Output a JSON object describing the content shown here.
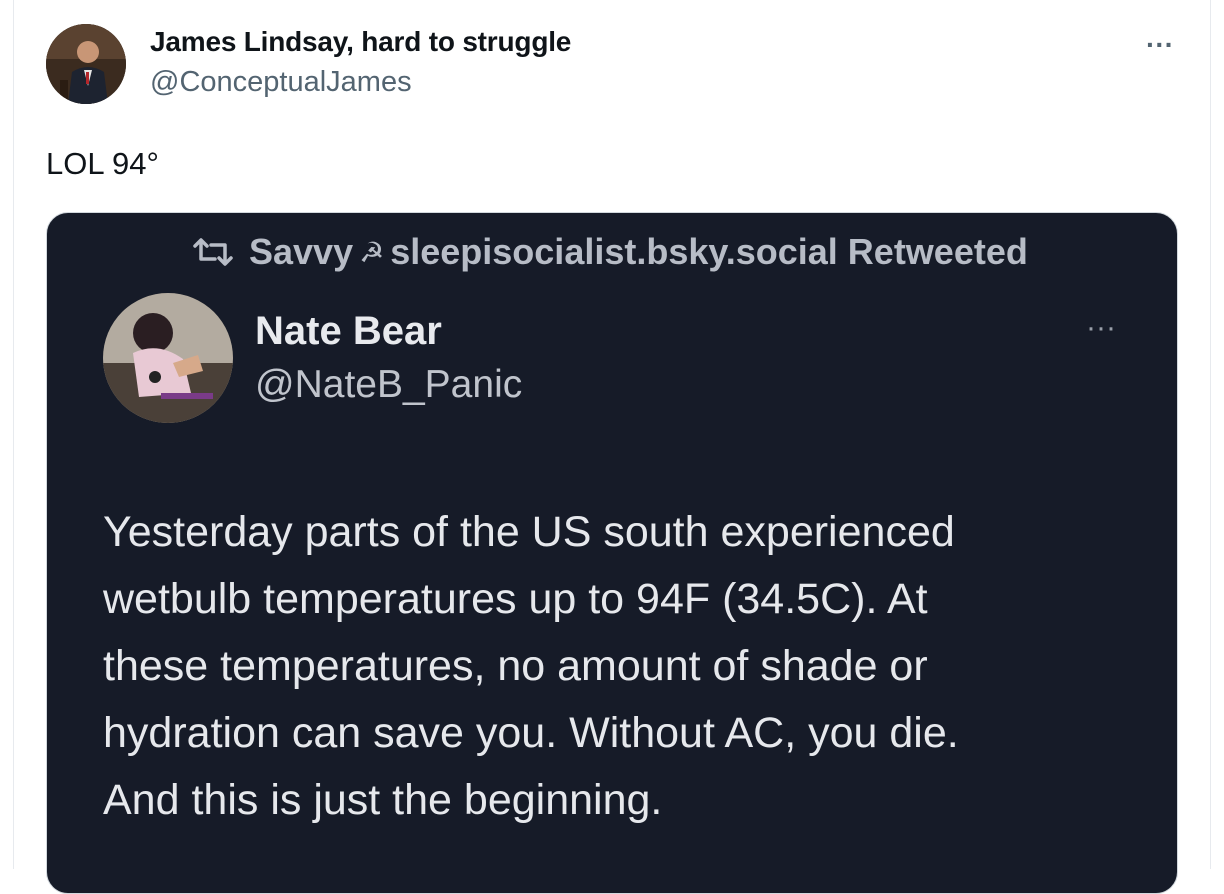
{
  "tweet": {
    "author_name": "James Lindsay, hard to struggle",
    "author_handle": "@ConceptualJames",
    "more_label": "···",
    "text": "LOL 94°",
    "avatar_icon": "user-avatar-photo"
  },
  "embedded_screenshot": {
    "retweet_icon": "retweet-icon",
    "retweeter": "Savvy",
    "retweeter_symbol": "☭",
    "retweeter_rest": "sleepisocialist.bsky.social Retweeted",
    "author_name": "Nate Bear",
    "author_handle": "@NateB_Panic",
    "more_label": "···",
    "body_lines": [
      "Yesterday parts of the US south experienced",
      "wetbulb temperatures up to 94F (34.5C). At",
      "these temperatures, no amount of shade or",
      "hydration can save you. Without AC, you die.",
      "And this is just the beginning."
    ],
    "colors": {
      "background": "#161b28",
      "text": "#e6e8ec",
      "muted": "#b7bcc6"
    }
  }
}
